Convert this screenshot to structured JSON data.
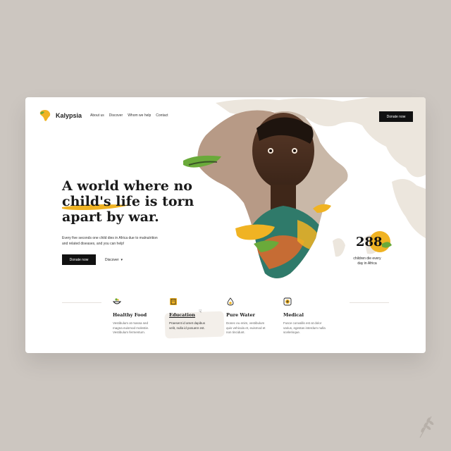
{
  "brand": {
    "name": "Kalypsia"
  },
  "nav": {
    "items": [
      {
        "label": "About us"
      },
      {
        "label": "Discover"
      },
      {
        "label": "Whom we help"
      },
      {
        "label": "Contact"
      }
    ],
    "donate_label": "Donate now"
  },
  "hero": {
    "headline_lines": [
      "A world where no",
      "child's life is torn",
      "apart by war."
    ],
    "subtext_lines": [
      "Every five seconds one child dies in Africa due to malnutrition",
      "and related diseases, and you can help!"
    ],
    "donate_label": "Donate now",
    "discover_label": "Discover"
  },
  "stat": {
    "number": "288",
    "caption_lines": [
      "children die every",
      "day in Africa"
    ]
  },
  "features": [
    {
      "title": "Healthy Food",
      "icon": "bowl-icon",
      "desc_lines": [
        "Vestibulum at massa sed",
        "magna euismod molestie.",
        "Vestibulum fermentum."
      ]
    },
    {
      "title": "Education",
      "icon": "book-icon",
      "desc_lines": [
        "Praesent id amet dapibus",
        "velit, nulla id posuere est."
      ]
    },
    {
      "title": "Pure Water",
      "icon": "water-drop-icon",
      "desc_lines": [
        "Donec eu enim, vestibulum",
        "quis vehicula et, euismod et",
        "non tincidunt."
      ]
    },
    {
      "title": "Medical",
      "icon": "medical-kit-icon",
      "desc_lines": [
        "Fusce convallis est at dolor",
        "varius, egestas interdum nulla",
        "scelerisque."
      ]
    }
  ],
  "colors": {
    "accent_yellow": "#f0b323",
    "accent_green": "#6aaa3a",
    "map_beige": "#ece6dd",
    "dark": "#111111",
    "page_bg": "#ccc6c0"
  }
}
